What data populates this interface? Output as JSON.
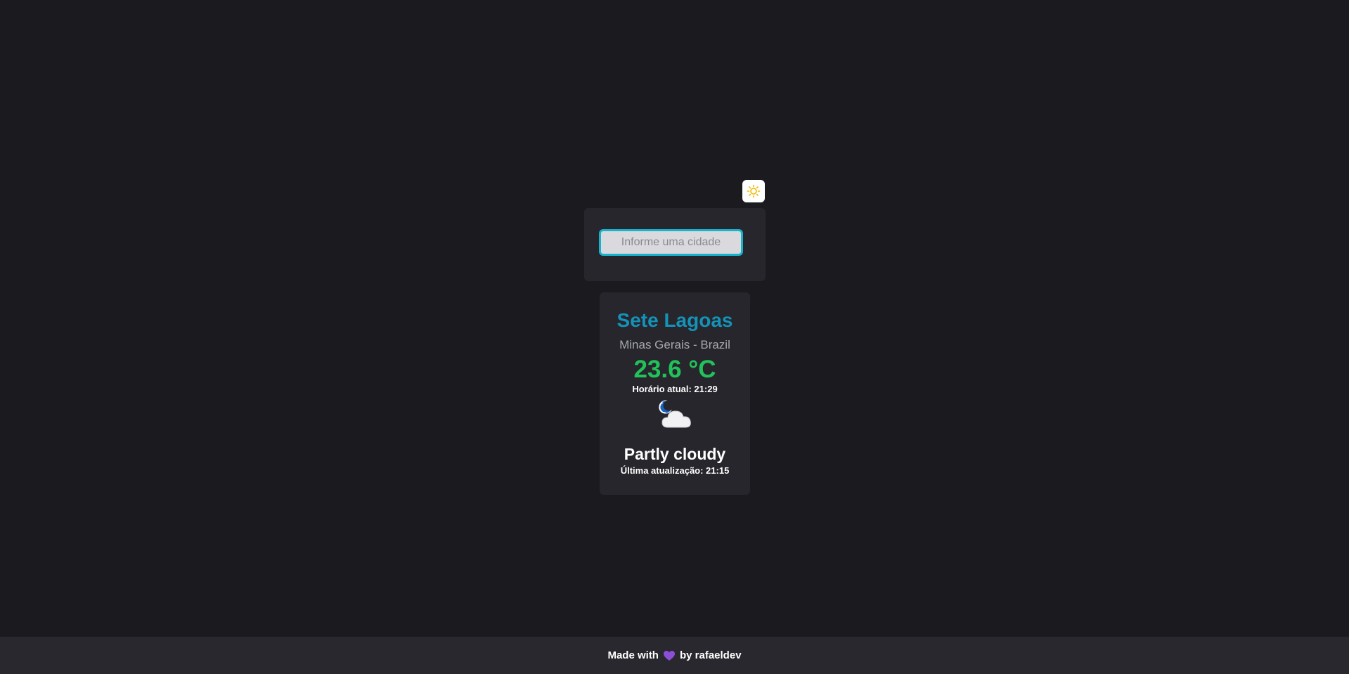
{
  "theme_toggle": {
    "icon": "sun-icon",
    "icon_color": "#f5b800"
  },
  "search": {
    "placeholder": "Informe uma cidade",
    "value": "",
    "border_color": "#17b3cc"
  },
  "weather": {
    "city": "Sete Lagoas",
    "region": "Minas Gerais - Brazil",
    "temperature": "23.6 °C",
    "current_time": "Horário atual: 21:29",
    "icon": "partly-cloudy-night-icon",
    "condition": "Partly cloudy",
    "last_update": "Última atualização: 21:15",
    "city_color": "#1592b8",
    "temperature_color": "#22c25a"
  },
  "footer": {
    "made_with": "Made with",
    "heart_icon": "heart-icon",
    "heart_color": "#8a4fd6",
    "by": "by rafaeldev"
  }
}
